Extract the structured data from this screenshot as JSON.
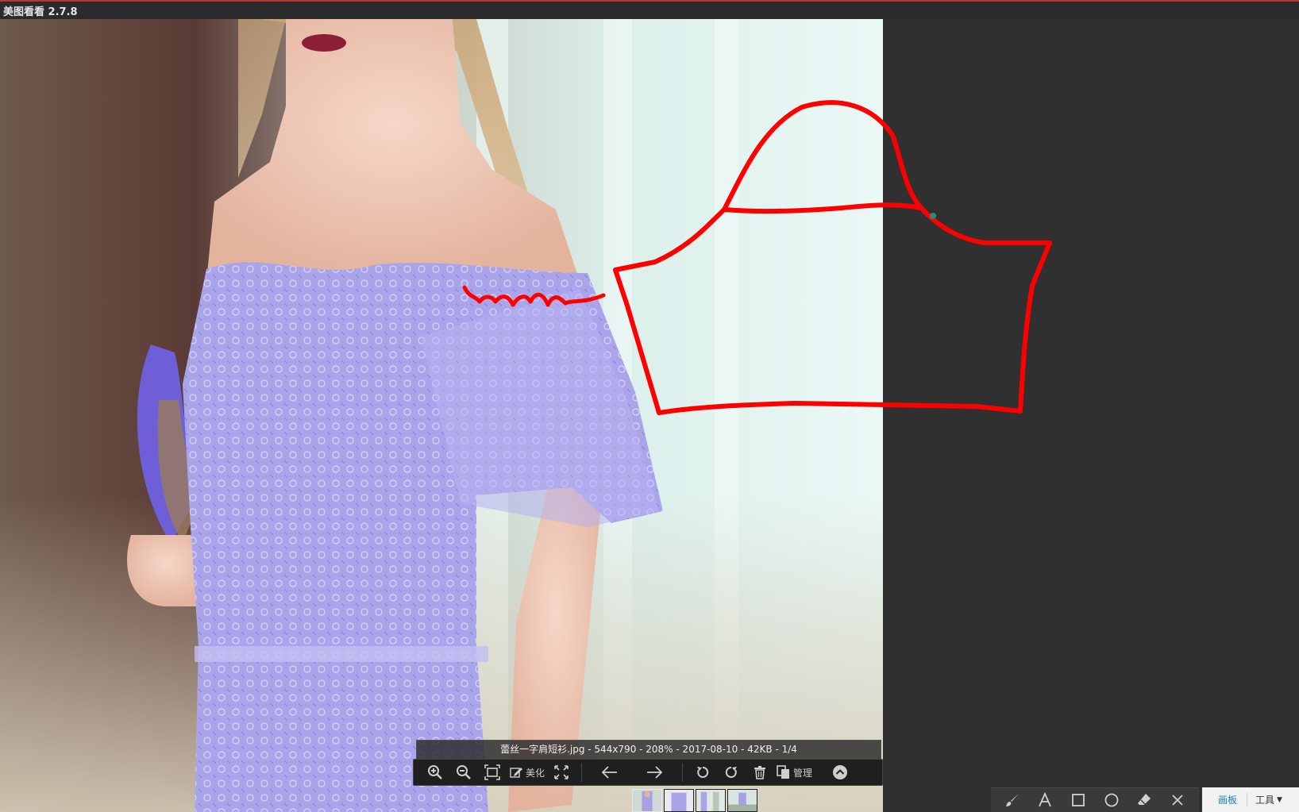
{
  "window": {
    "title": "美图看看 2.7.8"
  },
  "infobar": {
    "filename": "蕾丝一字肩短衫.jpg",
    "dimensions": "544x790",
    "zoom": "208%",
    "date": "2017-08-10",
    "filesize": "42KB",
    "position": "1/4",
    "text": "蕾丝一字肩短衫.jpg - 544x790 - 208% - 2017-08-10 - 42KB - 1/4"
  },
  "toolbar": {
    "zoom_in_icon": "zoom-in-icon",
    "zoom_out_icon": "zoom-out-icon",
    "fit_icon": "fit-screen-icon",
    "beautify_label": "美化",
    "fullscreen_icon": "fullscreen-icon",
    "prev_icon": "arrow-left-icon",
    "next_icon": "arrow-right-icon",
    "rotate_left_icon": "rotate-left-icon",
    "rotate_right_icon": "rotate-right-icon",
    "delete_icon": "trash-icon",
    "manage_label": "管理",
    "more_icon": "chevron-up-icon"
  },
  "thumbnails": {
    "count": 4,
    "active_index": 0
  },
  "drawtools": {
    "brush_icon": "brush-icon",
    "text_icon": "text-icon",
    "rect_icon": "rectangle-icon",
    "ellipse_icon": "ellipse-icon",
    "eraser_icon": "eraser-icon",
    "close_icon": "close-icon"
  },
  "paneltabs": {
    "canvas_label": "画板",
    "tools_label": "工具"
  },
  "colors": {
    "annotation_stroke": "#ff0000",
    "dress": "#a8a3e6",
    "background_panel": "#303030",
    "active_tab_text": "#1f7fd0"
  }
}
